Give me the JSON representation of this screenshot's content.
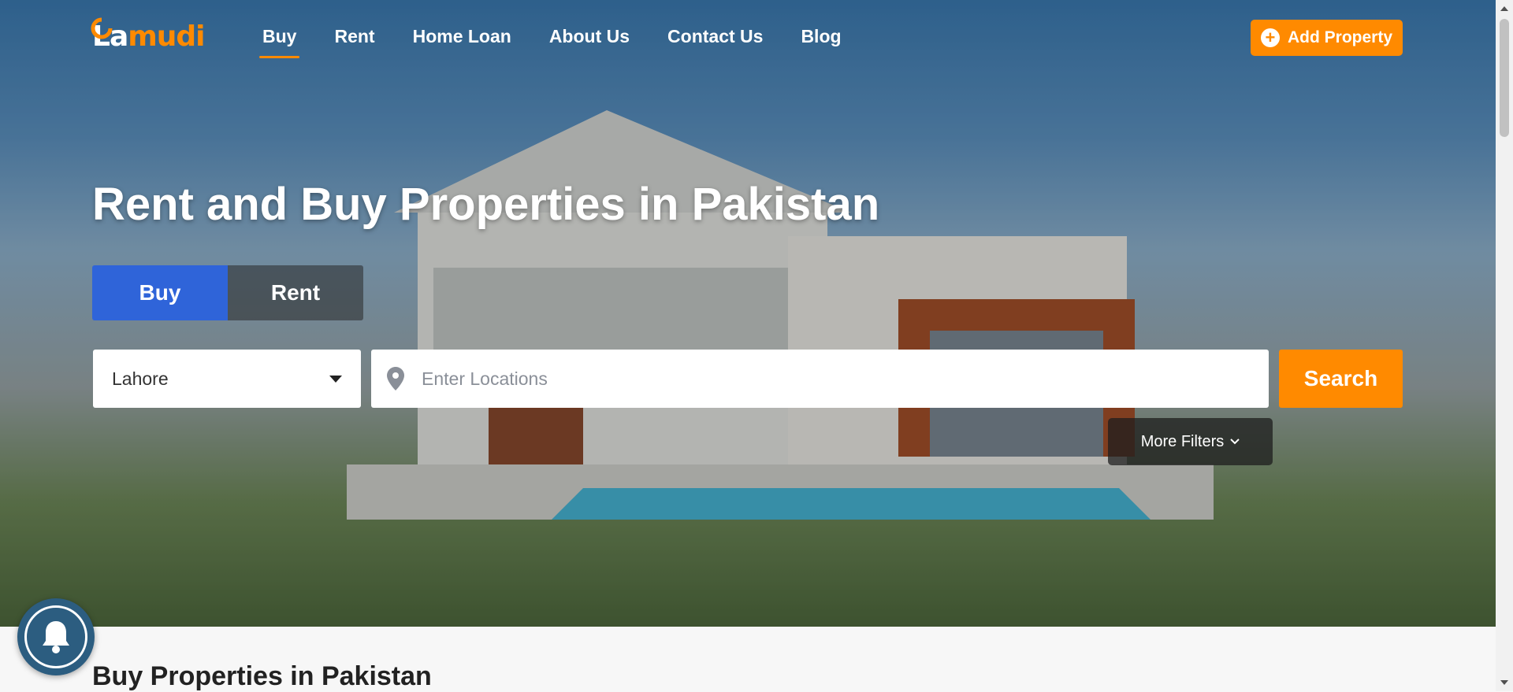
{
  "colors": {
    "accent": "#ff8a00",
    "buy_tab": "#2f64d9",
    "bell_bg": "#2c5d80"
  },
  "logo": {
    "text_main": "La",
    "text_tail": "mudi"
  },
  "nav": {
    "items": [
      {
        "label": "Buy",
        "active": true
      },
      {
        "label": "Rent"
      },
      {
        "label": "Home Loan"
      },
      {
        "label": "About Us"
      },
      {
        "label": "Contact Us"
      },
      {
        "label": "Blog"
      }
    ],
    "add_property": {
      "label": "Add Property",
      "icon": "plus-circle-icon"
    }
  },
  "hero": {
    "headline": "Rent and Buy Properties in Pakistan",
    "tabs": {
      "buy": "Buy",
      "rent": "Rent"
    },
    "city_select": {
      "value": "Lahore"
    },
    "location": {
      "placeholder": "Enter Locations",
      "icon": "map-pin-icon"
    },
    "search_label": "Search",
    "more_filters": "More Filters"
  },
  "section": {
    "title": "Buy Properties in Pakistan"
  }
}
